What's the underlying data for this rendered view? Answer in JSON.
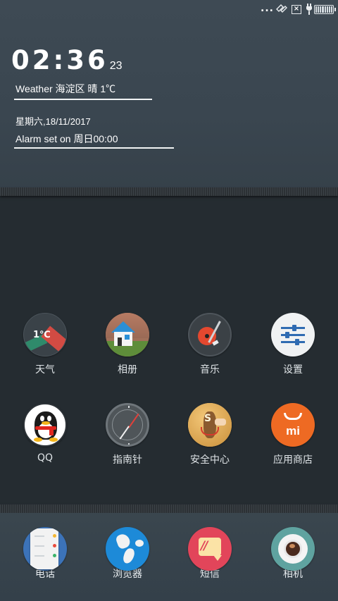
{
  "statusbar": {
    "dots": "...",
    "icons": [
      "signal-icon",
      "close-box-icon",
      "charging-icon",
      "battery-icon"
    ]
  },
  "clock": {
    "time": "02:36",
    "seconds": "23"
  },
  "weather": "Weather 海淀区 晴 1℃",
  "date": "星期六,18/11/2017",
  "alarm": "Alarm set on  周日00:00",
  "apps": [
    {
      "label": "天气",
      "icon": "weather-icon"
    },
    {
      "label": "相册",
      "icon": "gallery-icon"
    },
    {
      "label": "音乐",
      "icon": "music-icon"
    },
    {
      "label": "设置",
      "icon": "settings-icon"
    },
    {
      "label": "QQ",
      "icon": "qq-icon"
    },
    {
      "label": "指南针",
      "icon": "compass-icon"
    },
    {
      "label": "安全中心",
      "icon": "security-icon"
    },
    {
      "label": "应用商店",
      "icon": "app-store-icon"
    }
  ],
  "weather_icon_text": "1℃",
  "security_icon_text": "S",
  "store_icon_text": "mi",
  "dock": [
    {
      "label": "电话",
      "icon": "phone-icon"
    },
    {
      "label": "浏览器",
      "icon": "browser-icon"
    },
    {
      "label": "短信",
      "icon": "messages-icon"
    },
    {
      "label": "相机",
      "icon": "camera-icon"
    }
  ],
  "sms_icon_text": "//",
  "colors": {
    "background": "#252c31",
    "panel": "#3b4751",
    "accent_orange": "#ee6a23",
    "accent_red": "#e2455a"
  }
}
